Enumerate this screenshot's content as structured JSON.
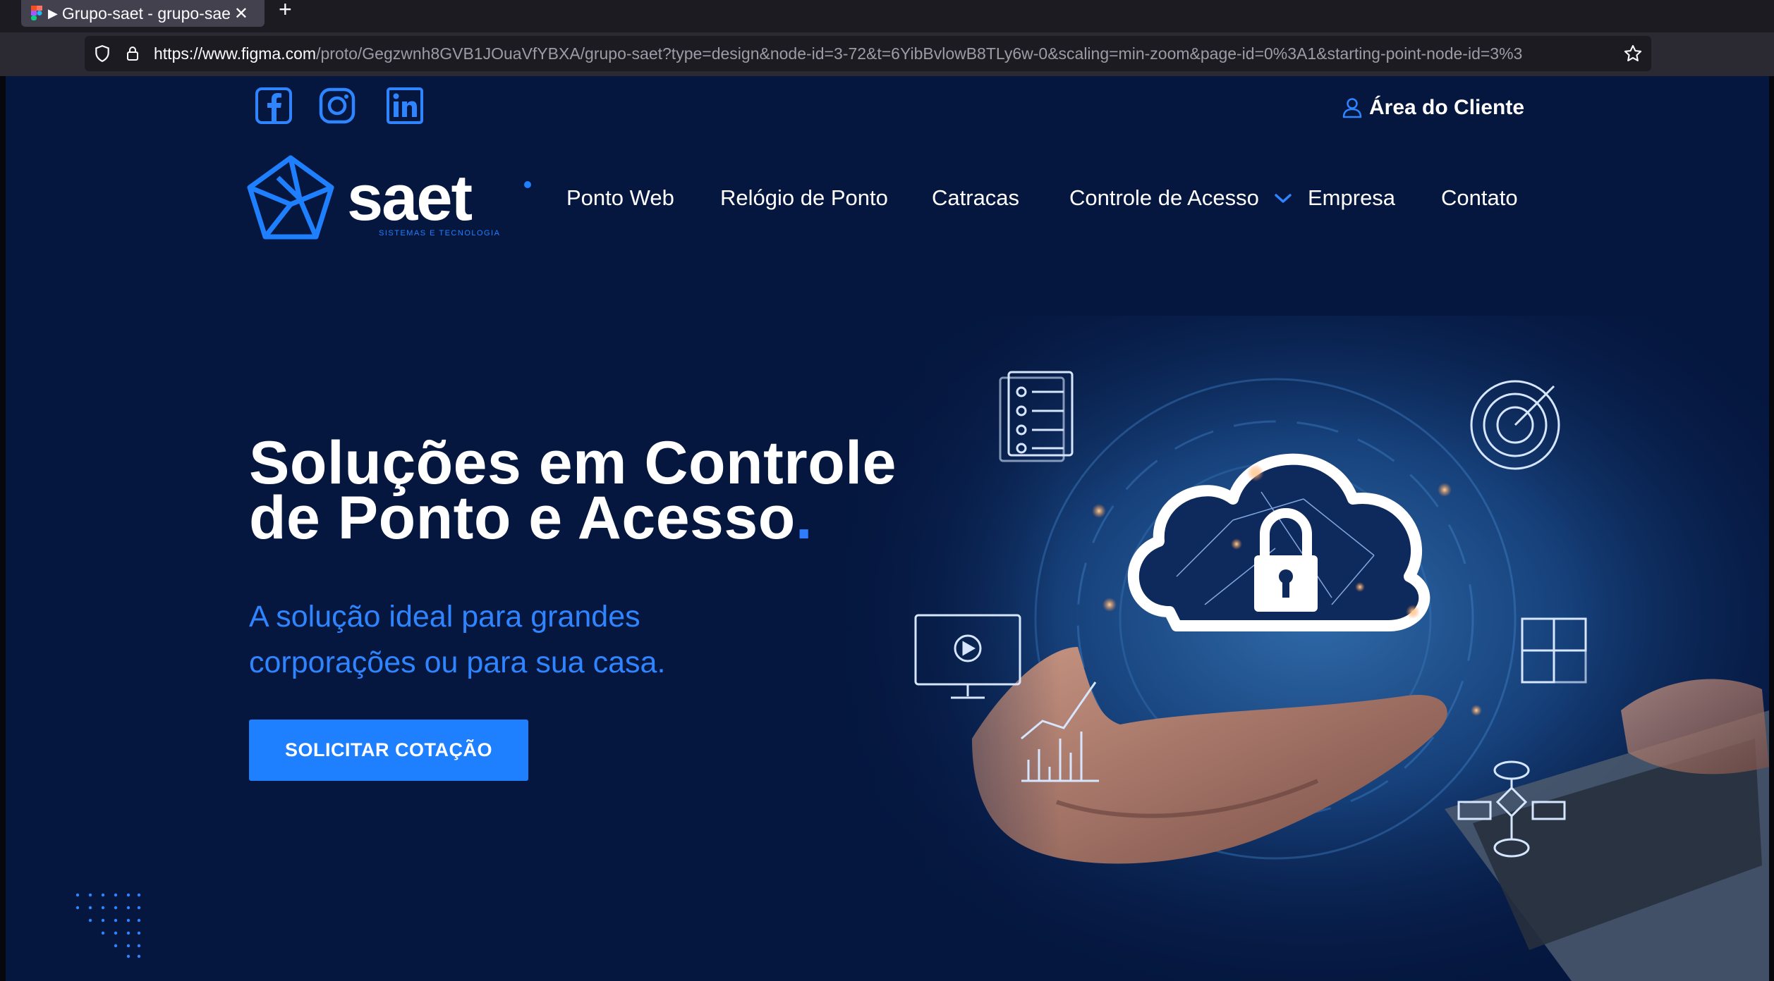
{
  "browser": {
    "tab_title": "Grupo-saet - grupo-sae",
    "url_host": "https://www.figma.com",
    "url_path": "/proto/Gegzwnh8GVB1JOuaVfYBXA/grupo-saet?type=design&node-id=3-72&t=6YibBvlowB8TLy6w-0&scaling=min-zoom&page-id=0%3A1&starting-point-node-id=3%3"
  },
  "topbar": {
    "social": [
      "facebook-icon",
      "instagram-icon",
      "linkedin-icon"
    ],
    "client_area": "Área do Cliente"
  },
  "logo": {
    "name": "saet",
    "tagline": "SISTEMAS E TECNOLOGIA"
  },
  "nav": {
    "items": [
      "Ponto Web",
      "Relógio de Ponto",
      "Catracas",
      "Controle de Acesso",
      "Empresa",
      "Contato"
    ]
  },
  "hero": {
    "title_line1": "Soluções em Controle",
    "title_line2": "de Ponto e Acesso",
    "title_dot": ".",
    "subtitle_line1": "A solução ideal para grandes",
    "subtitle_line2": "corporações ou para sua casa.",
    "cta": "SOLICITAR COTAÇÃO"
  },
  "colors": {
    "background": "#05173f",
    "accent": "#1f80ff",
    "subtitle": "#2f84ff",
    "text": "#ffffff"
  }
}
